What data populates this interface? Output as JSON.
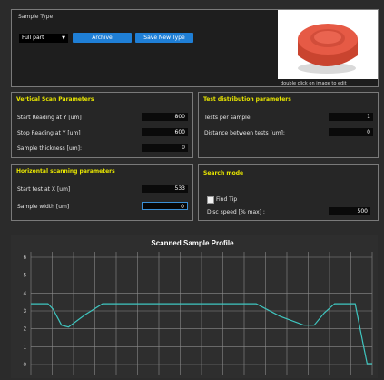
{
  "sample_type": {
    "title": "Sample Type",
    "dropdown_value": "Full part",
    "archive_button": "Archive",
    "save_type_button": "Save New Type",
    "image_caption": "double click on image to edit"
  },
  "vertical_scan": {
    "title": "Vertical Scan Parameters",
    "rows": [
      {
        "label": "Start Reading at Y [um]",
        "value": "800"
      },
      {
        "label": "Stop Reading at Y [um]",
        "value": "600"
      },
      {
        "label": "Sample thickness [um]:",
        "value": "0"
      }
    ]
  },
  "test_distribution": {
    "title": "Test distribution parameters",
    "rows": [
      {
        "label": "Tests per sample",
        "value": "1"
      },
      {
        "label": "Distance between tests [um]:",
        "value": "0"
      }
    ]
  },
  "horizontal_scan": {
    "title": "Horizontal scanning parameters",
    "rows": [
      {
        "label": "Start test at X [um]",
        "value": "533"
      },
      {
        "label": "Sample width [um]",
        "value": "0"
      }
    ]
  },
  "search_mode": {
    "title": "Search mode",
    "find_tip_label": "Find Tip",
    "find_tip_checked": false,
    "disc_speed_label": "Disc speed [% max] :",
    "disc_speed_value": "500"
  },
  "chart_data": {
    "type": "line",
    "title": "Scanned Sample Profile",
    "ylim": [
      0,
      6
    ],
    "yticks": [
      "6",
      "5",
      "4",
      "3",
      "2",
      "1",
      "0"
    ],
    "grid": true,
    "series": [
      {
        "color": "#3fc6c0",
        "points": [
          [
            0.0,
            3.4
          ],
          [
            0.05,
            3.4
          ],
          [
            0.065,
            3.1
          ],
          [
            0.09,
            2.2
          ],
          [
            0.11,
            2.1
          ],
          [
            0.16,
            2.8
          ],
          [
            0.21,
            3.4
          ],
          [
            0.55,
            3.4
          ],
          [
            0.66,
            3.4
          ],
          [
            0.73,
            2.7
          ],
          [
            0.8,
            2.2
          ],
          [
            0.83,
            2.2
          ],
          [
            0.86,
            2.9
          ],
          [
            0.89,
            3.4
          ],
          [
            0.95,
            3.4
          ],
          [
            0.975,
            1.0
          ],
          [
            0.985,
            0.05
          ],
          [
            1.0,
            0.05
          ]
        ]
      }
    ]
  },
  "colors": {
    "accent_title": "#e8e600",
    "button_blue": "#1f7fd6",
    "line": "#3fc6c0",
    "sample_image": "#e65a45"
  },
  "icons": {
    "dropdown": "triangle-down-icon",
    "sample_photo": "sample-image"
  }
}
